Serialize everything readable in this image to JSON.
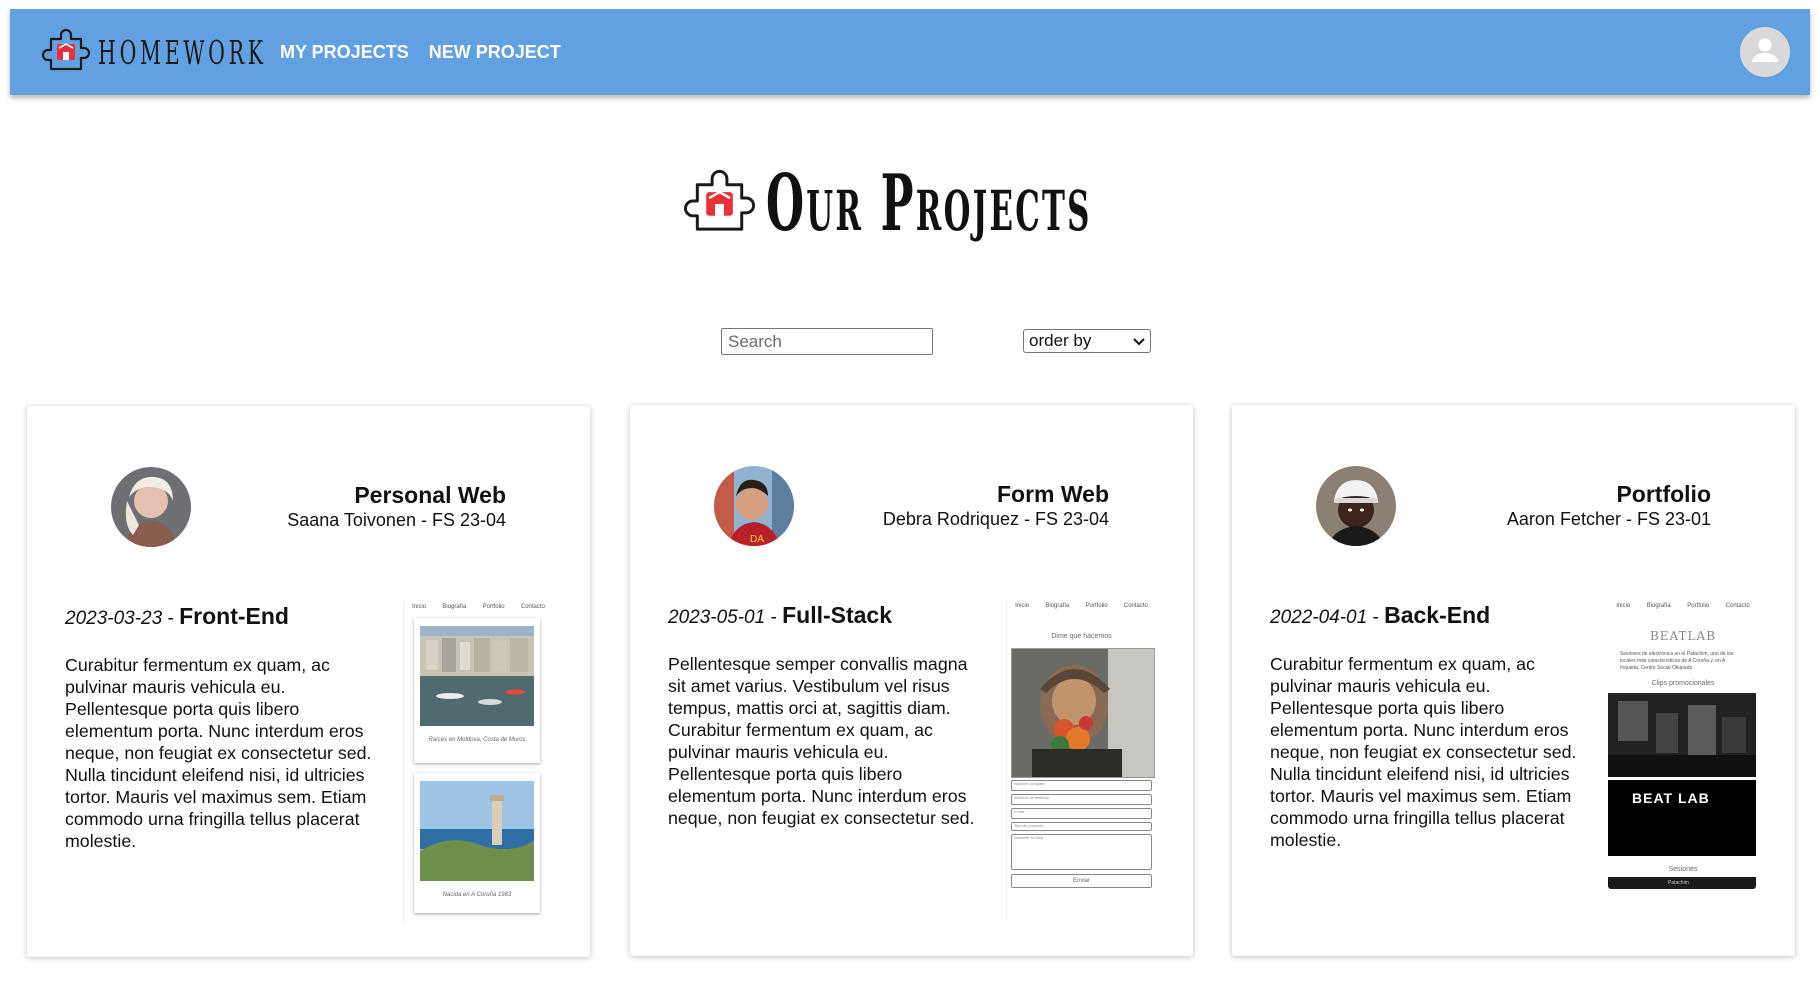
{
  "header": {
    "brand": "HOMEWORK",
    "nav": [
      "MY PROJECTS",
      "NEW PROJECT"
    ]
  },
  "page": {
    "title": "Our Projects"
  },
  "controls": {
    "search_placeholder": "Search",
    "order_label": "order by"
  },
  "cards": [
    {
      "title": "Personal Web",
      "author": "Saana Toivonen - FS 23-04",
      "date": "2023-03-23",
      "separator": " - ",
      "type": "Front-End",
      "description": "Curabitur fermentum ex quam, ac pulvinar mauris vehicula eu. Pellentesque porta quis libero elementum porta. Nunc interdum eros neque, non feugiat ex consectetur sed. Nulla tincidunt eleifend nisi, id ultricies tortor. Mauris vel maximus sem. Etiam commodo urna fringilla tellus placerat molestie."
    },
    {
      "title": "Form Web",
      "author": "Debra Rodriquez - FS 23-04",
      "date": "2023-05-01",
      "separator": " - ",
      "type": "Full-Stack",
      "description": "Pellentesque semper convallis magna sit amet varius. Vestibulum vel risus tempus, mattis orci at, sagittis diam. Curabitur fermentum ex quam, ac pulvinar mauris vehicula eu. Pellentesque porta quis libero elementum porta. Nunc interdum eros neque, non feugiat ex consectetur sed."
    },
    {
      "title": "Portfolio",
      "author": "Aaron Fetcher - FS 23-01",
      "date": "2022-04-01",
      "separator": " - ",
      "type": "Back-End",
      "description": "Curabitur fermentum ex quam, ac pulvinar mauris vehicula eu. Pellentesque porta quis libero elementum porta. Nunc interdum eros neque, non feugiat ex consectetur sed. Nulla tincidunt eleifend nisi, id ultricies tortor. Mauris vel maximus sem. Etiam commodo urna fringilla tellus placerat molestie."
    }
  ],
  "thumbnails": {
    "nav_items": [
      "Inicio",
      "Biografía",
      "Portfolio",
      "Contacto"
    ],
    "caption_1": "Raíces en Moldova, Costa de Muros",
    "caption_2": "Nacida en A Coruña 1983",
    "form_heading": "Dime que hacemos",
    "form_fields": [
      "Nombre completo",
      "Número de teléfono",
      "Email",
      "Tipo de proyecto",
      "Describe tu idea"
    ],
    "form_button": "Enviar",
    "portfolio_heading": "BEATLAB",
    "portfolio_intro": "Sesiones de electrónica en el Patachim, uno de los locales más característicos de A Coruña y, en A Inquieta, Centro Social Okupado.",
    "portfolio_subheading": "Clips promocionales",
    "portfolio_banner": "BEAT LAB",
    "portfolio_sessions": "Sesiones",
    "portfolio_footer": "Patachim"
  },
  "colors": {
    "header_bg": "#62a1e1",
    "header_text": "#ffffff",
    "logo_accent": "#e8323a",
    "avatar_bg": "#d9d9d9",
    "card_shadow": "rgba(0,0,0,0.25)"
  },
  "icons": {
    "logo": "puzzle-piece-house-icon",
    "user": "user-silhouette-icon",
    "select_arrow": "chevron-down-icon"
  }
}
